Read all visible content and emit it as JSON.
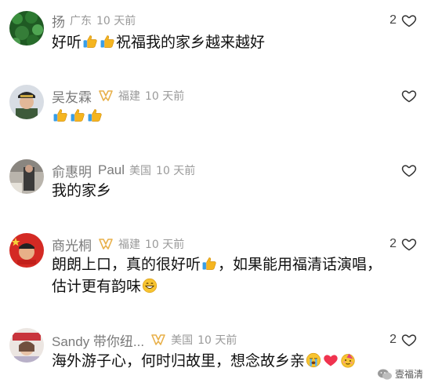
{
  "comments": [
    {
      "username": "扬",
      "location": "广东",
      "time": "10 天前",
      "likes": "2",
      "text_parts": [
        "好听",
        "祝福我的家乡越来越好"
      ]
    },
    {
      "username": "吴友霖",
      "location": "福建",
      "time": "10 天前",
      "likes": "",
      "text_parts": []
    },
    {
      "username": "俞惠明",
      "username_en": "Paul",
      "location": "美国",
      "time": "10 天前",
      "likes": "",
      "text_parts": [
        "我的家乡"
      ]
    },
    {
      "username": "商光桐",
      "location": "福建",
      "time": "10 天前",
      "likes": "2",
      "text_parts": [
        "朗朗上口，真的很好听",
        "，如果能用福清话演唱，",
        "估计更有韵味"
      ]
    },
    {
      "username": "Sandy 带你纽...",
      "location": "美国",
      "time": "10 天前",
      "likes": "2",
      "text_parts": [
        "海外游子心，何时归故里，想念故乡亲"
      ]
    }
  ],
  "icons": {
    "like": "heart-outline-icon",
    "badge": "member-badge-icon",
    "thumbs": "thumbs-up-emoji-icon"
  },
  "colors": {
    "meta": "#9a9a9a",
    "username": "#7a7a7a",
    "badge": "#e8b04a"
  },
  "watermark": {
    "label": "壹福清"
  }
}
